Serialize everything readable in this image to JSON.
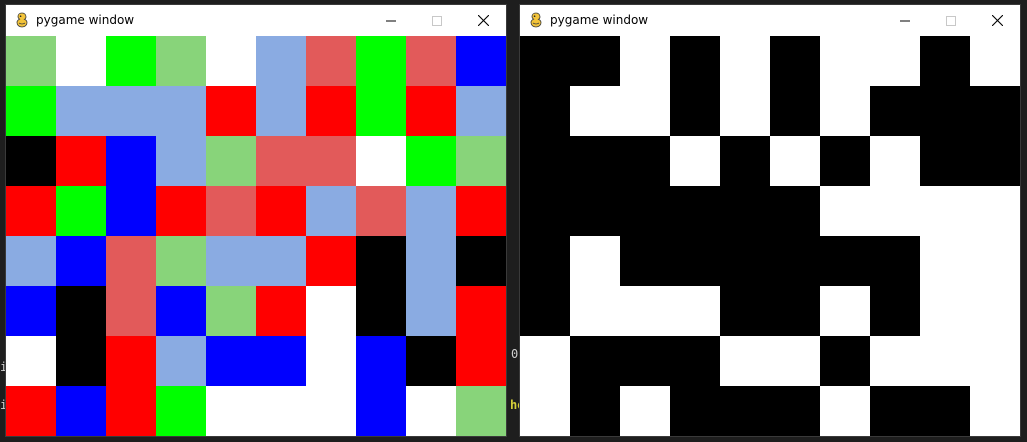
{
  "palette": {
    "G": "#88d47a",
    "W": "#ffffff",
    "L": "#00ff00",
    "B": "#8aabe2",
    "R": "#e25a5a",
    "D": "#0000ff",
    "E": "#ff0000",
    "K": "#000000"
  },
  "windows": [
    {
      "title": "pygame window",
      "minimize_icon": "minimize-icon",
      "maximize_icon": "maximize-icon",
      "close_icon": "close-icon",
      "grid": [
        "GWLGWBRLRD",
        "LBBBEBELEB",
        "KEDBGRRWLG",
        "ELDEREBRBE",
        "BDRGBBEKBK",
        "DKRDGEWKBE",
        "WKEBDDWDKE",
        "EDELWWWDWG"
      ]
    },
    {
      "title": "pygame window",
      "minimize_icon": "minimize-icon",
      "maximize_icon": "maximize-icon",
      "close_icon": "close-icon",
      "grid": [
        "KKWKWKWWKW",
        "KWWKWKWKKK",
        "KKKWKWKWKK",
        "KKKKKKWWWW",
        "KWKKKKKKWW",
        "KWWWKKWKW",
        "WKKKWWKWWW",
        "WKWKKKWKKW"
      ]
    }
  ],
  "background_text": {
    "left_a": "i",
    "left_b": "i",
    "mid_a": "0",
    "mid_b": "he"
  }
}
